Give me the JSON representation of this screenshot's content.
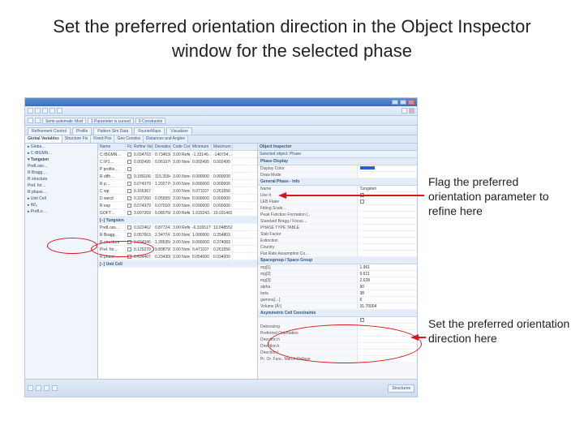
{
  "slide": {
    "title": "Set the preferred orientation direction in the Object Inspector window for the selected phase"
  },
  "callouts": {
    "flag": "Flag the preferred orientation parameter to refine here",
    "set": "Set the preferred orientation direction here"
  },
  "app": {
    "toolbar": {
      "mode_label": "Semi-automatic Mod",
      "param_label": "1 Parameter is cursed",
      "constraint_label": "0 Constraints"
    },
    "ribbon_tabs": [
      "Refinement Control",
      "Profile",
      "Pattern Sim Data",
      "FourierMaps",
      "Visualizer"
    ],
    "grid_tabs": [
      "Global Variables",
      "Structure Fix",
      "Fixed Pos",
      "Geo Constra",
      "Distances and Angles"
    ],
    "grid_headers": [
      "Name",
      "Fix",
      "Refine Value",
      "Deviation",
      "Code Constra",
      "Minimum",
      "Maximum"
    ],
    "sections": {
      "tungsten": "[−] Tungsten",
      "unitcell": "[−] Unit Cell",
      "prefloss": "PrefLoss…"
    },
    "tree": [
      "▸ Globa…",
      "▸ C:\\BGMN…",
      "▾ Tungsten",
      "   PrefLoss…",
      "   R Bragg…",
      "   R structure",
      "   Pref. for…",
      "   R phase…",
      "▸ Unit Cell",
      "▸ W/₀",
      "▸ PrefLo…"
    ],
    "rows": [
      {
        "name": "C:\\BGMN…",
        "fix": "",
        "rv": "0.034763",
        "dev": "0.734638",
        "cc": "3.00 Refine",
        "min": "-1.33146…",
        "max": "-140704…"
      },
      {
        "name": "C:\\P1…",
        "fix": "",
        "rv": "0.002495",
        "dev": "0.061076",
        "cc": "3.00 None",
        "min": "0.002495",
        "max": "0.002495"
      },
      {
        "name": "P profile…",
        "fix": "",
        "rv": "",
        "dev": "",
        "cc": "",
        "min": "",
        "max": ""
      },
      {
        "name": "R diffr…",
        "fix": "✓",
        "rv": "0.189106",
        "dev": "115.3184",
        "cc": "3.00 None",
        "min": "0.000000",
        "max": "0.000000"
      },
      {
        "name": "R p…",
        "fix": "",
        "rv": "0.074379",
        "dev": "1.202776",
        "cc": "3.00 None",
        "min": "0.000000",
        "max": "0.000000"
      },
      {
        "name": "C wp",
        "fix": "",
        "rv": "0.165367",
        "dev": "",
        "cc": "3.00 None",
        "min": "0.071107",
        "max": "0.261556"
      },
      {
        "name": "D wecd",
        "fix": "",
        "rv": "0.337260",
        "dev": "0.055555",
        "cc": "3.00 None",
        "min": "0.000000",
        "max": "0.000000"
      },
      {
        "name": "R exp",
        "fix": "",
        "rv": "0.074379",
        "dev": "0.070109",
        "cc": "3.00 None",
        "min": "0.000000",
        "max": "0.000000"
      },
      {
        "name": "GOFT…",
        "fix": "",
        "rv": "3.097269",
        "dev": "0.080768",
        "cc": "3.00 Refine",
        "min": "1.915243…",
        "max": "19.031469"
      },
      {
        "name": "PrefLoss…",
        "fix": "",
        "rv": "0.922462",
        "dev": "0.877243",
        "cc": "3.00 Refine",
        "min": "-6.316517…",
        "max": "10.048552"
      },
      {
        "name": "R Bragg…",
        "fix": "",
        "rv": "0.057663",
        "dev": "2.347741",
        "cc": "3.00 None",
        "min": "1.000000",
        "max": "0.354803"
      },
      {
        "name": "R structure",
        "fix": "",
        "rv": "0.034346",
        "dev": "1.285356",
        "cc": "3.00 None",
        "min": "0.000000",
        "max": "0.374083"
      },
      {
        "name": "Pref. for…",
        "fix": "",
        "rv": "0.125278",
        "dev": "9.808795",
        "cc": "3.00 None",
        "min": "0.471107",
        "max": "0.261556"
      },
      {
        "name": "R phase…",
        "fix": "",
        "rv": "0.634407",
        "dev": "0.234306",
        "cc": "3.00 None",
        "min": "0.054000",
        "max": "0.034000"
      }
    ],
    "inspector": {
      "title": "Object Inspector",
      "subtitle": "Selected object: Phase",
      "sec_display": "Phase Display",
      "display_color_k": "Display Color",
      "draw_mode_k": "Draw Mode",
      "sec_info": "General Phase - Info",
      "sec_name_k": "Name",
      "sec_name_v": "Tungsten",
      "use_k": "Use It",
      "lebail_k": "LEB Flake",
      "fitting_k": "Fitting Scale…",
      "peak_k": "Peak Function Formation [..",
      "bragg_k": "Standard Bragg / Focus…",
      "phase_type_k": "PHASE TYPE TABLE",
      "slab_k": "Slab Factor",
      "ext_k": "Extinction",
      "count_k": "Country",
      "flat_k": "Flat Rate Assumption Co…",
      "sec_sg": "Spacegroup / Space Group",
      "mg1_k": "mg[1]",
      "mg1_v": "1.961",
      "mg2_k": "mg[2]",
      "mg2_v": "9.611",
      "mg3_k": "mg[3]",
      "mg3_v": "2.628",
      "alpha_k": "alpha",
      "alpha_v": "90",
      "beta_k": "beta",
      "beta_v": "38",
      "gamma_k": "gamma[…]",
      "gamma_v": "6",
      "vol_k": "Volume [Å³]",
      "vol_v": "31.70004",
      "sec_asym": "Asymmetric Cell Constraints",
      "asym_fix_k": "",
      "asym_fix_v": "✓",
      "dbl_k": "Deboozing",
      "po_k": "Preferred Orientation",
      "dir_h_k": "Direction h",
      "dir_k_k": "Direction k",
      "dir_l_k": "Direction l",
      "po_func_k": "Pr. Or. Func.  March-Dollase"
    },
    "footer_tab": "Structures"
  }
}
